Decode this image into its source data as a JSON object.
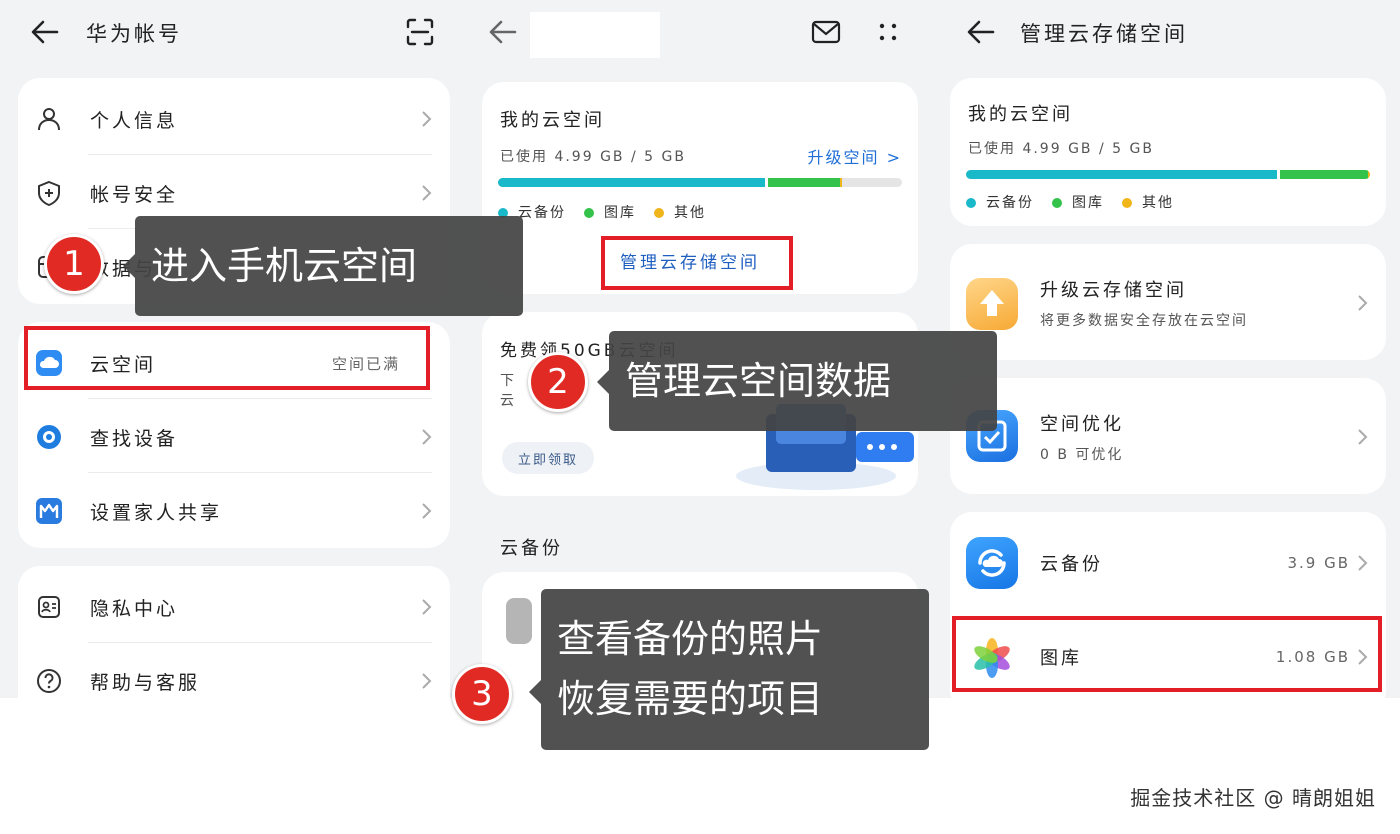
{
  "panel1": {
    "title": "华为帐号",
    "items_group1": [
      {
        "label": "个人信息",
        "icon": "person-icon"
      },
      {
        "label": "帐号安全",
        "icon": "shield-icon"
      },
      {
        "label": "数据与",
        "icon": "data-icon"
      }
    ],
    "items_group2": [
      {
        "label": "云空间",
        "value": "空间已满",
        "icon": "cloud-icon"
      },
      {
        "label": "查找设备",
        "icon": "find-device-icon"
      },
      {
        "label": "设置家人共享",
        "icon": "family-share-icon"
      }
    ],
    "items_group3": [
      {
        "label": "隐私中心",
        "icon": "privacy-icon"
      },
      {
        "label": "帮助与客服",
        "icon": "help-icon"
      }
    ]
  },
  "panel2": {
    "storage": {
      "title": "我的云空间",
      "used_text": "已使用 4.99 GB / 5 GB",
      "upgrade_link": "升级空间 >",
      "legend": [
        "云备份",
        "图库",
        "其他"
      ],
      "segments": [
        0.66,
        0.18,
        0.005
      ],
      "colors": [
        "#1ab9c9",
        "#33c24a",
        "#f1b51c"
      ],
      "manage_link": "管理云存储空间"
    },
    "promo": {
      "title": "免费领50GB云空间",
      "desc_lines": [
        "下",
        "云"
      ],
      "claim_button": "立即领取"
    },
    "backup_section": "云备份"
  },
  "panel3": {
    "title": "管理云存储空间",
    "storage": {
      "title": "我的云空间",
      "used_text": "已使用 4.99 GB / 5 GB",
      "legend": [
        "云备份",
        "图库",
        "其他"
      ],
      "segments": [
        0.78,
        0.22,
        0.005
      ]
    },
    "upgrade": {
      "title": "升级云存储空间",
      "subtitle": "将更多数据安全存放在云空间"
    },
    "optimize": {
      "title": "空间优化",
      "subtitle": "0 B 可优化"
    },
    "apps": [
      {
        "label": "云备份",
        "size": "3.9 GB"
      },
      {
        "label": "图库",
        "size": "1.08 GB"
      }
    ]
  },
  "callouts": [
    {
      "num": "1",
      "text": "进入手机云空间"
    },
    {
      "num": "2",
      "text": "管理云空间数据"
    },
    {
      "num": "3",
      "lines": [
        "查看备份的照片",
        "恢复需要的项目"
      ]
    }
  ],
  "watermark": "掘金技术社区 @ 晴朗姐姐"
}
